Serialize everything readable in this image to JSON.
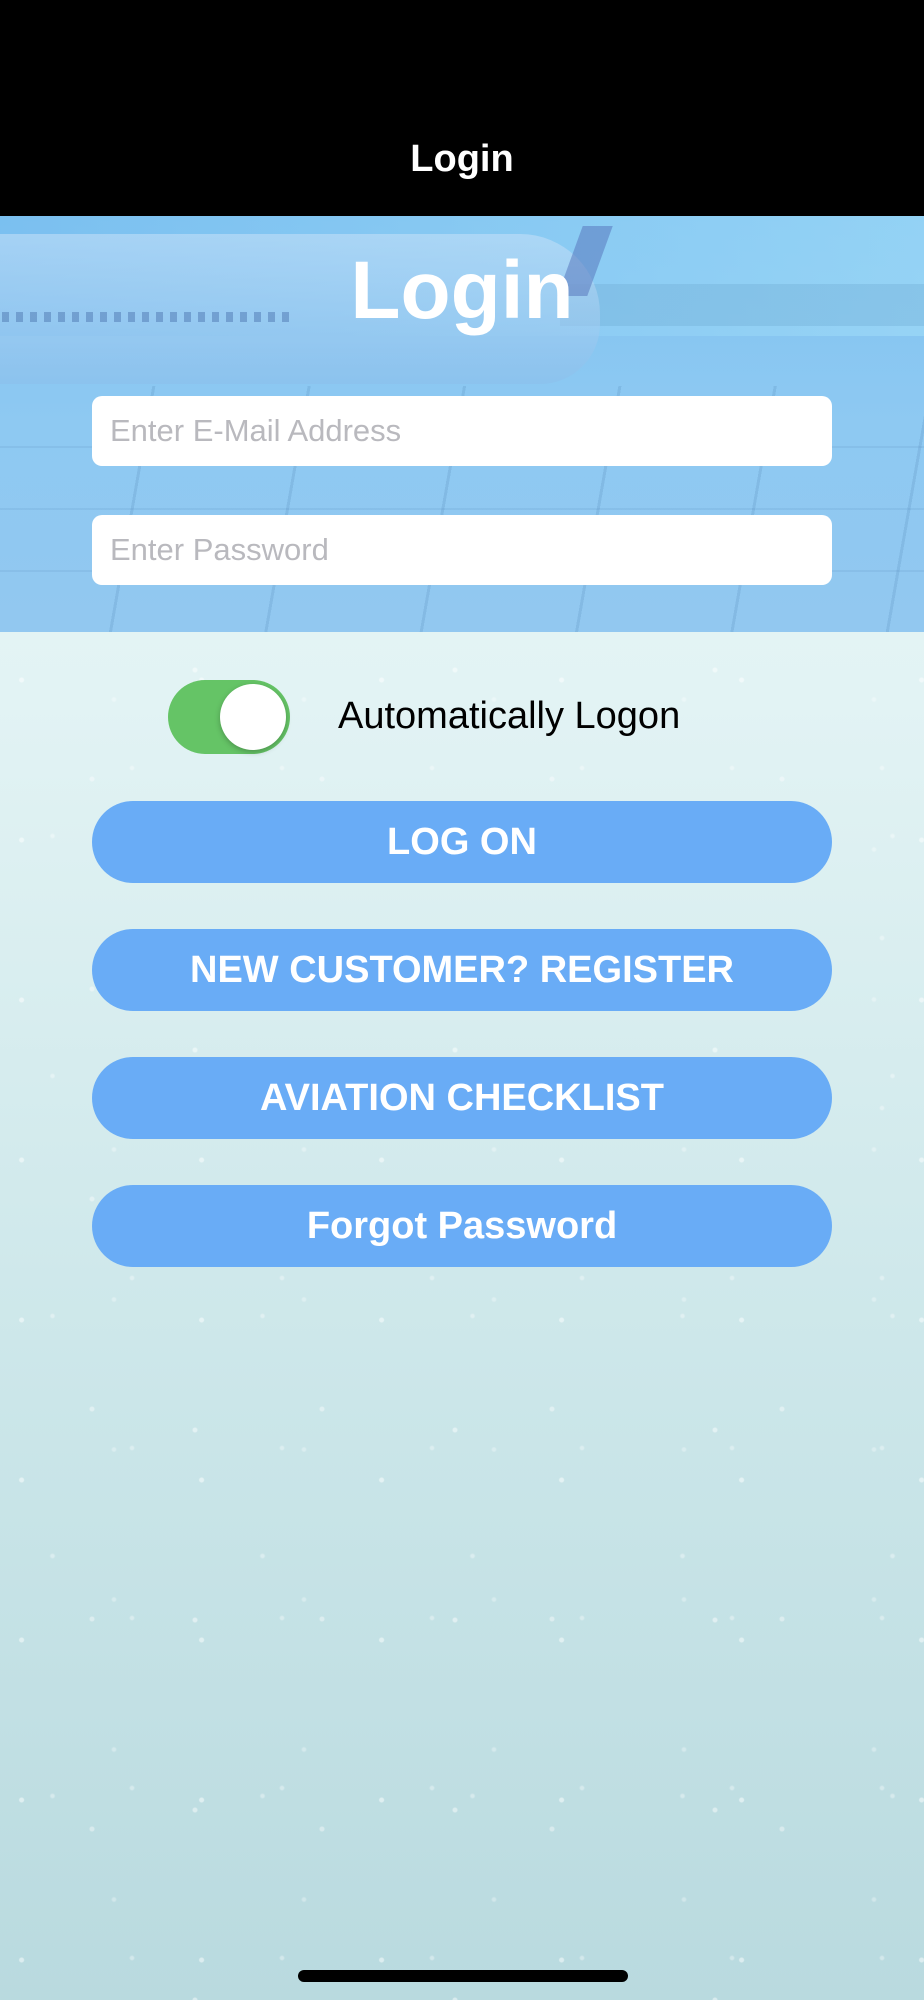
{
  "nav": {
    "title": "Login"
  },
  "hero": {
    "title": "Login"
  },
  "form": {
    "email_placeholder": "Enter E-Mail Address",
    "email_value": "",
    "password_placeholder": "Enter Password",
    "password_value": ""
  },
  "auto_logon": {
    "label": "Automatically Logon",
    "enabled": true
  },
  "buttons": {
    "log_on": "LOG ON",
    "register": "NEW CUSTOMER? REGISTER",
    "checklist": "AVIATION CHECKLIST",
    "forgot": "Forgot Password"
  },
  "colors": {
    "nav_background": "#000000",
    "button_blue": "#69acf6",
    "toggle_green": "#65c466"
  }
}
